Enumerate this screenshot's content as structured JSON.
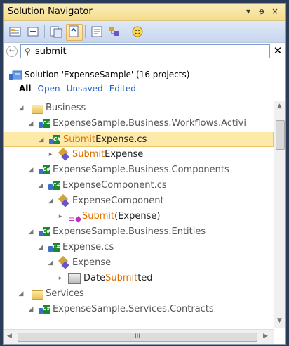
{
  "window": {
    "title": "Solution Navigator",
    "controls": [
      "▾",
      "ᵽ",
      "×"
    ]
  },
  "toolbar": {
    "buttons": [
      "properties-icon",
      "collapse-icon",
      "show-all-files-icon",
      "sync-icon",
      "new-view-icon",
      "class-view-icon",
      "feedback-smiley-icon"
    ],
    "active_index": 3
  },
  "search": {
    "query": "submit",
    "clear_label": "✕"
  },
  "solution": {
    "label": "Solution 'ExpenseSample' (16 projects)",
    "filters": [
      "All",
      "Open",
      "Unsaved",
      "Edited"
    ],
    "selected_filter": "All"
  },
  "tree": {
    "rows": [
      {
        "label": "Business"
      },
      {
        "label": "ExpenseSample.Business.Workflows.Activi"
      },
      {
        "pre": "",
        "match": "Submit",
        "post": "Expense.cs"
      },
      {
        "pre": "",
        "match": "Submit",
        "post": "Expense"
      },
      {
        "label": "ExpenseSample.Business.Components"
      },
      {
        "label": "ExpenseComponent.cs"
      },
      {
        "label": "ExpenseComponent"
      },
      {
        "pre": "",
        "match": "Submit",
        "post": "(Expense)"
      },
      {
        "label": "ExpenseSample.Business.Entities"
      },
      {
        "label": "Expense.cs"
      },
      {
        "label": "Expense"
      },
      {
        "pre": "Date",
        "match": "Submit",
        "post": "ted"
      },
      {
        "label": "Services"
      },
      {
        "label": "ExpenseSample.Services.Contracts"
      }
    ]
  },
  "scroll": {
    "h_thumb_grip": "III"
  },
  "colors": {
    "title_bar": "#f5dc89",
    "highlight_row": "#fde9a8",
    "match_text": "#e07000",
    "filter_link": "#1f5fbf",
    "frame": "#2b3c59"
  }
}
